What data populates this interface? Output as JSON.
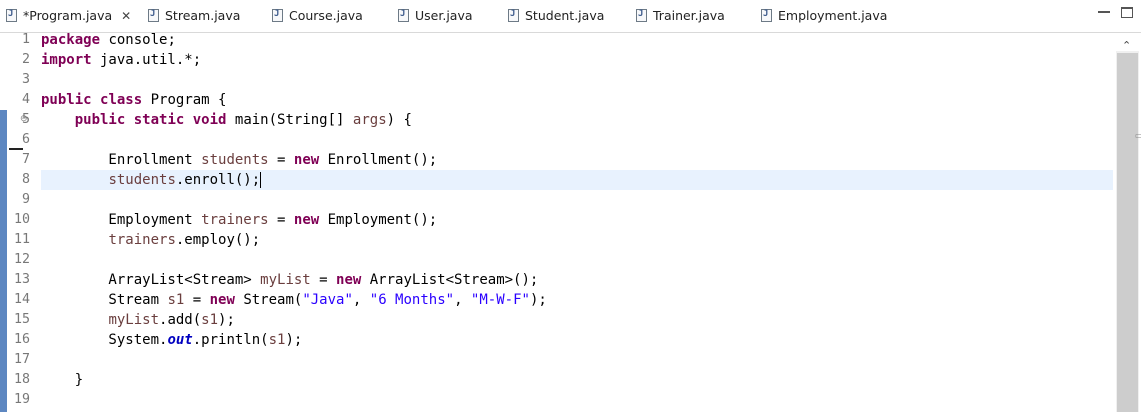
{
  "tabs": [
    {
      "label": "*Program.java",
      "active": true,
      "close": "✕"
    },
    {
      "label": "Stream.java"
    },
    {
      "label": "Course.java"
    },
    {
      "label": "User.java"
    },
    {
      "label": "Student.java"
    },
    {
      "label": "Trainer.java"
    },
    {
      "label": "Employment.java"
    }
  ],
  "editor": {
    "line_numbers": [
      "1",
      "2",
      "3",
      "4",
      "5",
      "6",
      "7",
      "8",
      "9",
      "10",
      "11",
      "12",
      "13",
      "14",
      "15",
      "16",
      "17",
      "18",
      "19"
    ],
    "lines": [
      [
        {
          "t": "package",
          "c": "kw"
        },
        {
          "t": " console;"
        }
      ],
      [
        {
          "t": "import",
          "c": "kw"
        },
        {
          "t": " java.util.*;"
        }
      ],
      [],
      [
        {
          "t": "public",
          "c": "kw"
        },
        {
          "t": " "
        },
        {
          "t": "class",
          "c": "kw"
        },
        {
          "t": " Program {"
        }
      ],
      [
        {
          "t": "    "
        },
        {
          "t": "public",
          "c": "kw"
        },
        {
          "t": " "
        },
        {
          "t": "static",
          "c": "kw"
        },
        {
          "t": " "
        },
        {
          "t": "void",
          "c": "kw"
        },
        {
          "t": " main(String[] "
        },
        {
          "t": "args",
          "c": "var"
        },
        {
          "t": ") {"
        }
      ],
      [],
      [
        {
          "t": "        Enrollment "
        },
        {
          "t": "students",
          "c": "var"
        },
        {
          "t": " = "
        },
        {
          "t": "new",
          "c": "kw"
        },
        {
          "t": " Enrollment();"
        }
      ],
      [
        {
          "t": "        "
        },
        {
          "t": "students",
          "c": "var"
        },
        {
          "t": ".enroll();"
        }
      ],
      [],
      [
        {
          "t": "        Employment "
        },
        {
          "t": "trainers",
          "c": "var"
        },
        {
          "t": " = "
        },
        {
          "t": "new",
          "c": "kw"
        },
        {
          "t": " Employment();"
        }
      ],
      [
        {
          "t": "        "
        },
        {
          "t": "trainers",
          "c": "var"
        },
        {
          "t": ".employ();"
        }
      ],
      [],
      [
        {
          "t": "        ArrayList<Stream> "
        },
        {
          "t": "myList",
          "c": "var"
        },
        {
          "t": " = "
        },
        {
          "t": "new",
          "c": "kw"
        },
        {
          "t": " ArrayList<Stream>();"
        }
      ],
      [
        {
          "t": "        Stream "
        },
        {
          "t": "s1",
          "c": "var"
        },
        {
          "t": " = "
        },
        {
          "t": "new",
          "c": "kw"
        },
        {
          "t": " Stream("
        },
        {
          "t": "\"Java\"",
          "c": "str"
        },
        {
          "t": ", "
        },
        {
          "t": "\"6 Months\"",
          "c": "str"
        },
        {
          "t": ", "
        },
        {
          "t": "\"M-W-F\"",
          "c": "str"
        },
        {
          "t": ");"
        }
      ],
      [
        {
          "t": "        "
        },
        {
          "t": "myList",
          "c": "var"
        },
        {
          "t": ".add("
        },
        {
          "t": "s1",
          "c": "var"
        },
        {
          "t": ");"
        }
      ],
      [
        {
          "t": "        System."
        },
        {
          "t": "out",
          "c": "fld"
        },
        {
          "t": ".println("
        },
        {
          "t": "s1",
          "c": "var"
        },
        {
          "t": ");"
        }
      ],
      [],
      [
        {
          "t": "    }"
        }
      ],
      []
    ],
    "current_line": 8
  }
}
